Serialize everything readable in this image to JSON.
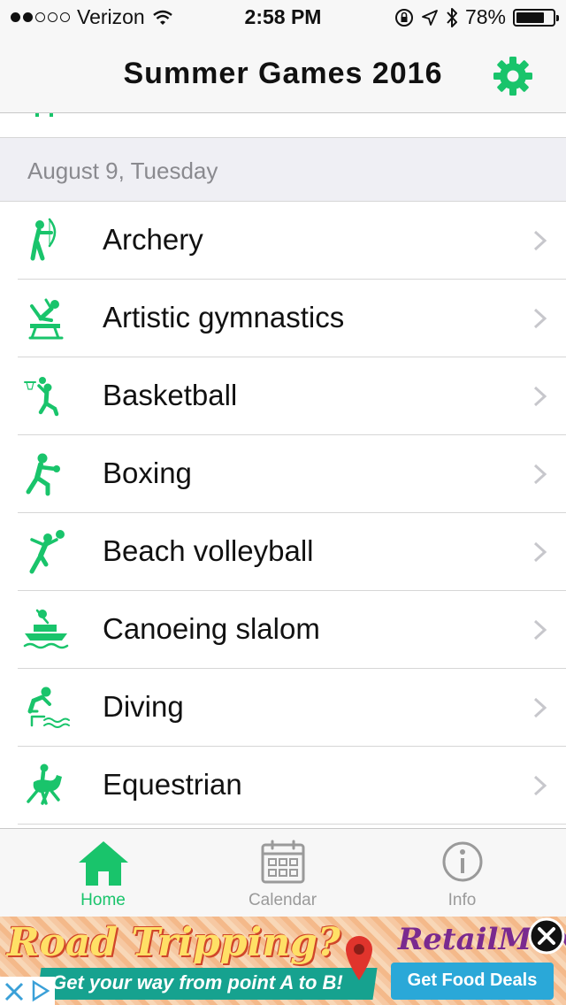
{
  "status_bar": {
    "carrier": "Verizon",
    "signal_bars_filled": 2,
    "signal_bars_total": 5,
    "time": "2:58 PM",
    "battery": "78%",
    "battery_level": 0.78
  },
  "nav": {
    "title": "Summer Games 2016",
    "settings_icon": "gear-icon"
  },
  "section": {
    "header": "August 9, Tuesday"
  },
  "events": [
    {
      "label": "Archery",
      "icon": "archery-icon"
    },
    {
      "label": "Artistic gymnastics",
      "icon": "gymnastics-icon"
    },
    {
      "label": "Basketball",
      "icon": "basketball-icon"
    },
    {
      "label": "Boxing",
      "icon": "boxing-icon"
    },
    {
      "label": "Beach volleyball",
      "icon": "beach-volleyball-icon"
    },
    {
      "label": "Canoeing slalom",
      "icon": "canoeing-icon"
    },
    {
      "label": "Diving",
      "icon": "diving-icon"
    },
    {
      "label": "Equestrian",
      "icon": "equestrian-icon"
    }
  ],
  "tab_bar": {
    "tabs": [
      {
        "label": "Home",
        "icon": "home-icon",
        "active": true
      },
      {
        "label": "Calendar",
        "icon": "calendar-icon",
        "active": false
      },
      {
        "label": "Info",
        "icon": "info-icon",
        "active": false
      }
    ]
  },
  "ad": {
    "headline": "Road Tripping?",
    "subline": "Get your way from point A to B!",
    "brand": "RetailMeNot",
    "cta": "Get Food Deals"
  },
  "colors": {
    "accent": "#19c46b",
    "inactive": "#9a9a9a",
    "section_bg": "#efeff4",
    "bar_bg": "#f7f7f7"
  }
}
